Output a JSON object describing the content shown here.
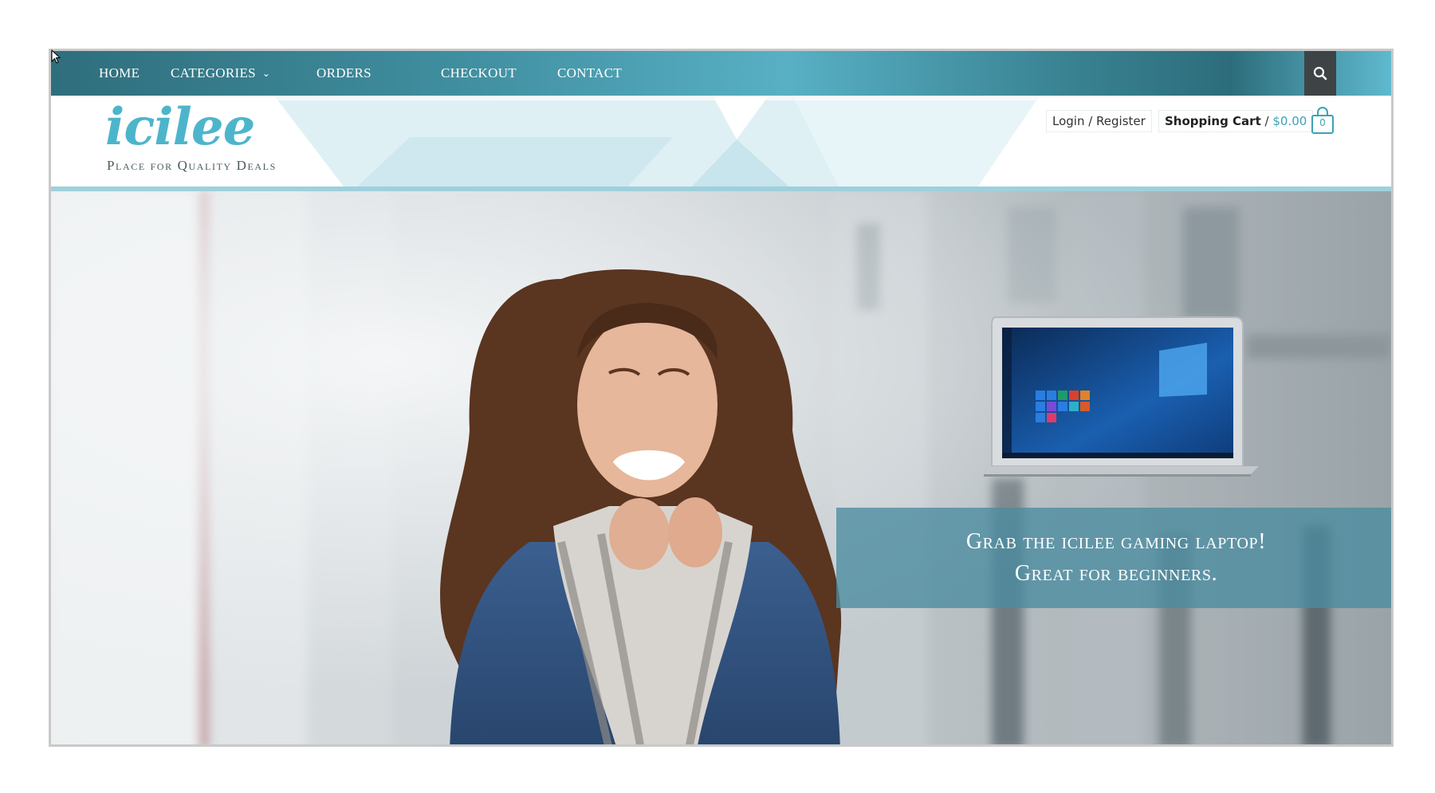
{
  "nav": {
    "items": [
      {
        "label": "Home"
      },
      {
        "label": "Categories"
      },
      {
        "label": "Orders"
      },
      {
        "label": "Checkout"
      },
      {
        "label": "Contact"
      }
    ],
    "search_icon": "search-icon"
  },
  "header": {
    "logo": "icilee",
    "tagline": "Place for Quality Deals",
    "login_label": "Login / Register",
    "cart_label": "Shopping Cart",
    "cart_separator": "/",
    "cart_total": "$0.00",
    "cart_count": "0"
  },
  "hero": {
    "caption_line1": "Grab the icilee gaming laptop!",
    "caption_line2": "Great for beginners."
  },
  "colors": {
    "accent": "#4db5cb",
    "nav_dark": "#2f6e7c",
    "search_bg": "#3e4446",
    "caption_bg": "#4a8ca0"
  }
}
